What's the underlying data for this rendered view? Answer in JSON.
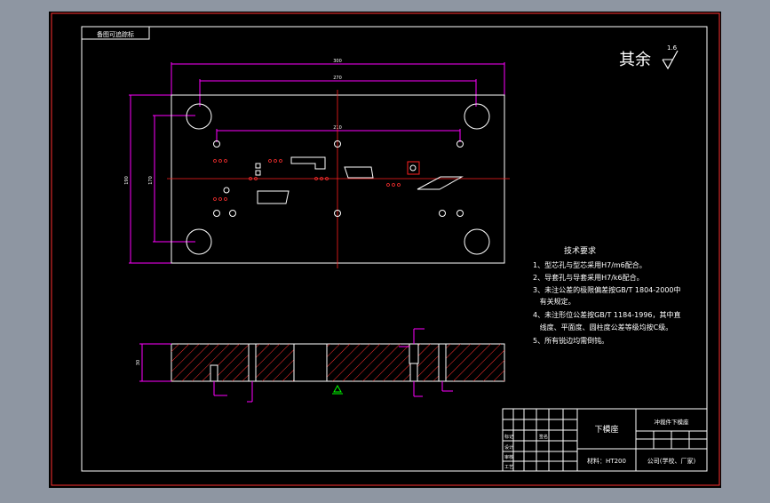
{
  "drawing": {
    "corner_tag": "备图可追踪标",
    "roughness": {
      "prefix": "其余",
      "value": "1.6"
    },
    "dims": {
      "overall_width": "300",
      "hole_span": "270",
      "inner_span": "210",
      "height_overall": "190",
      "height_inner": "170",
      "thickness": "30"
    },
    "tech_requirements": {
      "title": "技术要求",
      "lines": [
        "1、型芯孔与型芯采用H7/m6配合。",
        "2、导套孔与导套采用H7/k6配合。",
        "3、未注公差的极限偏差按GB/T 1804-2000中",
        "   有关规定。",
        "4、未注形位公差按GB/T 1184-1996，其中直",
        "   线度、平面度、圆柱度公差等级均按C级。",
        "5、所有锐边均需倒钝。"
      ]
    },
    "title_block": {
      "part_name": "下模座",
      "project": "冲裁件下模座",
      "material": "材料：HT200",
      "company": "公司(学校、厂家)",
      "label_mark": "标记",
      "label_design": "设计",
      "label_check": "审核",
      "label_process": "工艺",
      "label_sign": "签名"
    }
  },
  "colors": {
    "frame_bg": "#000000",
    "outline": "#ffffff",
    "dimension": "#ff00ff",
    "center_line": "#ff2020",
    "hatch": "#ff3030",
    "datum": "#00ff00",
    "label": "#ffff00"
  }
}
